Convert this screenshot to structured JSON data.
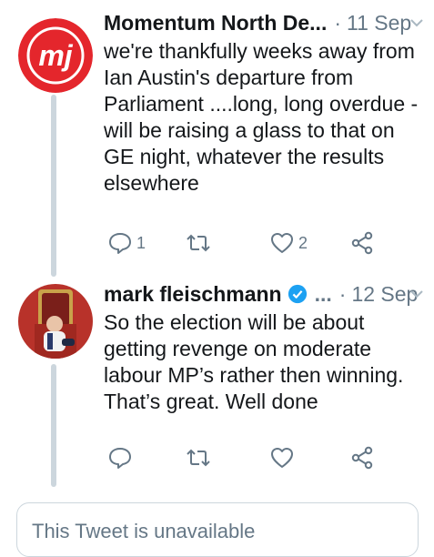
{
  "tweets": [
    {
      "author": "Momentum North De...",
      "date": "11 Sep",
      "text": "we're thankfully weeks away from Ian Austin's departure from Parliament ....long, long overdue - will be raising a glass to that on GE night, whatever the results elsewhere",
      "replies": "1",
      "retweets": "",
      "likes": "2",
      "avatar": {
        "label": "mj",
        "color": "#e4262c"
      }
    },
    {
      "author": "mark fleischmann",
      "verified": true,
      "ellipsis": "...",
      "date": "12 Sep",
      "text": "So the election will be about getting revenge on moderate labour MP’s rather then winning. That’s great. Well done",
      "replies": "",
      "retweets": "",
      "likes": ""
    }
  ],
  "unavailable_notice": "This Tweet is unavailable",
  "colors": {
    "accent": "#1da1f2",
    "muted": "#657786",
    "thread": "#ccd6dd"
  }
}
